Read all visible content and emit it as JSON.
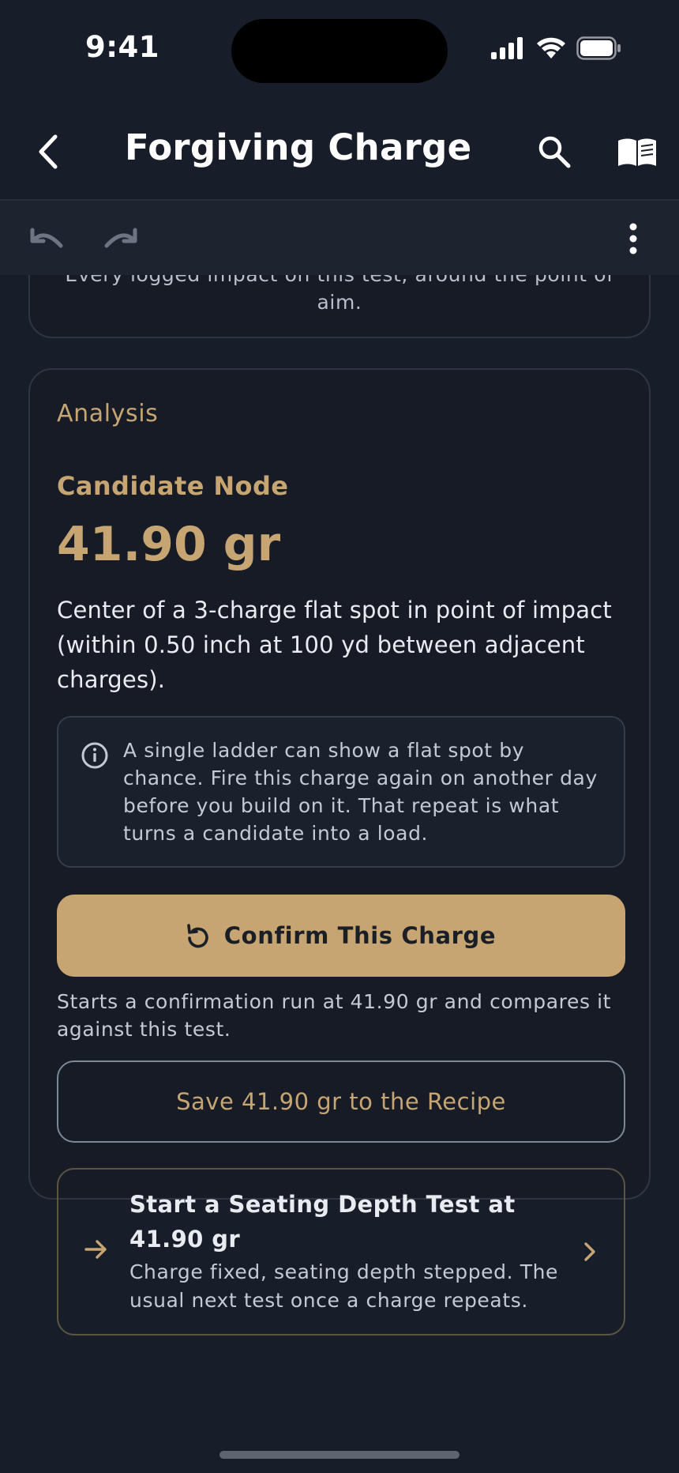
{
  "status_bar": {
    "time": "9:41"
  },
  "app_bar": {
    "title": "Forgiving Charge"
  },
  "previous_card": {
    "caption": "Every logged impact on this test, around the point of aim."
  },
  "analysis": {
    "section_label": "Analysis",
    "node_label": "Candidate Node",
    "node_value": "41.90 gr",
    "description": "Center of a 3-charge flat spot in point of impact (within 0.50 inch at 100 yd between adjacent charges).",
    "info_text": "A single ladder can show a flat spot by chance. Fire this charge again on another day before you build on it. That repeat is what turns a candidate into a load.",
    "confirm_label": "Confirm This Charge",
    "confirm_help": "Starts a confirmation run at 41.90 gr and compares it against this test.",
    "save_label": "Save 41.90 gr to the Recipe",
    "next_title": "Start a Seating Depth Test at 41.90 gr",
    "next_desc": "Charge fixed, seating depth stepped. The usual next test once a charge repeats."
  },
  "colors": {
    "background": "#181e29",
    "accent": "#c6a573",
    "card": "#161b25"
  },
  "icons": [
    "back-icon",
    "search-icon",
    "book-icon",
    "undo-icon",
    "redo-icon",
    "more-vert-icon",
    "info-icon",
    "refresh-icon",
    "arrow-right-icon",
    "chevron-right-icon"
  ]
}
